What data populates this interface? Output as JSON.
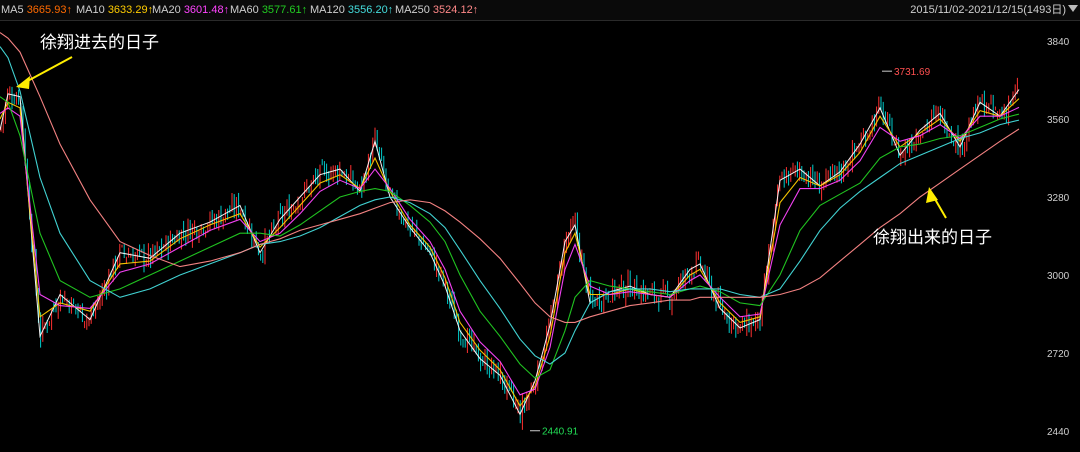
{
  "legend": [
    {
      "name": "MA5",
      "value": "3665.93↑",
      "color": "#ffffff"
    },
    {
      "name": "MA10",
      "value": "3633.29↑",
      "color": "#ffcc00"
    },
    {
      "name": "MA20",
      "value": "3601.48↑",
      "color": "#ff44ff"
    },
    {
      "name": "MA60",
      "value": "3577.61↑",
      "color": "#22cc22"
    },
    {
      "name": "MA120",
      "value": "3556.20↑",
      "color": "#44dddd"
    },
    {
      "name": "MA250",
      "value": "3524.12↑",
      "color": "#ff8888"
    }
  ],
  "range_label": "2015/11/02-2021/12/15(1493日)",
  "annotations": {
    "enter": "徐翔进去的日子",
    "exit": "徐翔出来的日子"
  },
  "chart_data": {
    "type": "line",
    "y_ticks": [
      "3840",
      "3560",
      "3280",
      "3000",
      "2720",
      "2440"
    ],
    "ylim": [
      2430,
      3870
    ],
    "grid": false,
    "max_label": "3731.69",
    "min_label": "2440.91",
    "colors": {
      "up": "#ff3030",
      "down": "#00cccc",
      "ma5": "#ffffff",
      "ma10": "#ffcc00",
      "ma20": "#ff44ff",
      "ma60": "#22cc22",
      "ma120": "#44dddd",
      "ma250": "#ff8888",
      "arrow": "#ffee00"
    },
    "x": [
      0,
      8,
      20,
      40,
      60,
      90,
      120,
      150,
      180,
      210,
      240,
      260,
      280,
      300,
      320,
      340,
      360,
      375,
      390,
      410,
      430,
      445,
      460,
      480,
      500,
      520,
      535,
      550,
      565,
      575,
      590,
      610,
      630,
      650,
      670,
      690,
      700,
      720,
      740,
      760,
      780,
      800,
      820,
      840,
      860,
      880,
      900,
      920,
      940,
      960,
      980,
      1000,
      1019
    ],
    "series": [
      {
        "name": "MA5",
        "values": [
          3520,
          3650,
          3640,
          2780,
          2930,
          2840,
          3080,
          3060,
          3150,
          3190,
          3250,
          3080,
          3200,
          3280,
          3360,
          3380,
          3300,
          3480,
          3280,
          3170,
          3080,
          2960,
          2800,
          2700,
          2640,
          2500,
          2620,
          2820,
          3120,
          3180,
          2900,
          2940,
          2960,
          2930,
          2920,
          3020,
          3040,
          2880,
          2810,
          2840,
          3340,
          3380,
          3320,
          3370,
          3470,
          3600,
          3430,
          3520,
          3580,
          3460,
          3620,
          3570,
          3665.93
        ]
      },
      {
        "name": "MA10",
        "values": [
          3560,
          3620,
          3600,
          2850,
          2900,
          2870,
          3040,
          3050,
          3130,
          3180,
          3220,
          3100,
          3170,
          3250,
          3330,
          3360,
          3310,
          3420,
          3300,
          3180,
          3100,
          2990,
          2830,
          2730,
          2660,
          2530,
          2600,
          2780,
          3080,
          3150,
          2930,
          2930,
          2950,
          2930,
          2920,
          3000,
          3020,
          2900,
          2830,
          2850,
          3260,
          3350,
          3320,
          3360,
          3440,
          3570,
          3460,
          3510,
          3560,
          3480,
          3590,
          3570,
          3633.29
        ]
      },
      {
        "name": "MA20",
        "values": [
          3580,
          3600,
          3570,
          2930,
          2890,
          2880,
          3010,
          3040,
          3100,
          3160,
          3200,
          3120,
          3150,
          3220,
          3300,
          3340,
          3310,
          3380,
          3310,
          3200,
          3120,
          3020,
          2870,
          2760,
          2690,
          2570,
          2590,
          2740,
          3020,
          3110,
          2960,
          2930,
          2940,
          2930,
          2920,
          2980,
          3000,
          2920,
          2850,
          2860,
          3180,
          3310,
          3310,
          3340,
          3410,
          3530,
          3480,
          3500,
          3540,
          3490,
          3570,
          3570,
          3601.48
        ]
      },
      {
        "name": "MA60",
        "values": [
          3640,
          3620,
          3500,
          3150,
          2980,
          2920,
          2950,
          3000,
          3050,
          3100,
          3150,
          3150,
          3140,
          3180,
          3230,
          3280,
          3300,
          3310,
          3300,
          3250,
          3190,
          3120,
          3000,
          2870,
          2780,
          2680,
          2630,
          2660,
          2800,
          2920,
          2980,
          2960,
          2950,
          2940,
          2930,
          2950,
          2960,
          2940,
          2900,
          2890,
          3000,
          3160,
          3250,
          3290,
          3330,
          3420,
          3460,
          3470,
          3490,
          3500,
          3530,
          3560,
          3577.61
        ]
      },
      {
        "name": "MA120",
        "values": [
          3820,
          3780,
          3660,
          3350,
          3150,
          2980,
          2920,
          2950,
          3000,
          3040,
          3080,
          3110,
          3120,
          3140,
          3170,
          3210,
          3250,
          3270,
          3280,
          3260,
          3220,
          3170,
          3090,
          2980,
          2880,
          2770,
          2710,
          2680,
          2720,
          2800,
          2900,
          2940,
          2950,
          2950,
          2940,
          2950,
          2950,
          2950,
          2930,
          2920,
          2950,
          3050,
          3160,
          3240,
          3300,
          3350,
          3400,
          3430,
          3460,
          3490,
          3510,
          3540,
          3556.2
        ]
      },
      {
        "name": "MA250",
        "values": [
          3870,
          3850,
          3800,
          3640,
          3470,
          3270,
          3120,
          3070,
          3030,
          3050,
          3080,
          3110,
          3130,
          3160,
          3180,
          3200,
          3220,
          3240,
          3260,
          3270,
          3260,
          3230,
          3190,
          3130,
          3060,
          2970,
          2900,
          2850,
          2830,
          2830,
          2850,
          2870,
          2890,
          2900,
          2910,
          2910,
          2920,
          2920,
          2920,
          2920,
          2930,
          2950,
          2990,
          3050,
          3110,
          3170,
          3220,
          3280,
          3330,
          3380,
          3430,
          3480,
          3524.12
        ]
      }
    ]
  }
}
